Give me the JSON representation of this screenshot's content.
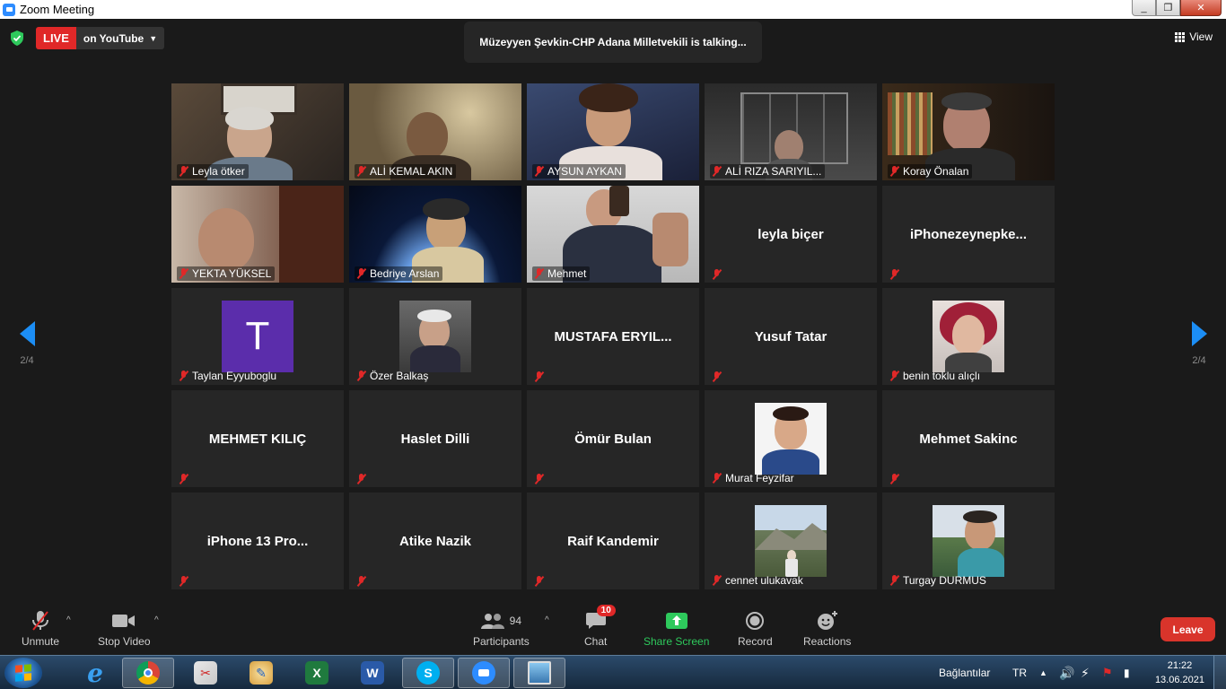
{
  "window": {
    "title": "Zoom Meeting",
    "buttons": [
      "_",
      "❐",
      "✕"
    ]
  },
  "topbar": {
    "live_label": "LIVE",
    "live_target": "on YouTube",
    "talking": "Müzeyyen Şevkin-CHP Adana Milletvekili is talking...",
    "view_label": "View"
  },
  "pagination": {
    "left": "2/4",
    "right": "2/4"
  },
  "tiles": [
    {
      "name": "Leyla ötker",
      "kind": "video"
    },
    {
      "name": "ALİ KEMAL AKIN",
      "kind": "video"
    },
    {
      "name": "AYSUN AYKAN",
      "kind": "video"
    },
    {
      "name": "ALİ RIZA SARIYIL...",
      "kind": "video"
    },
    {
      "name": "Koray Önalan",
      "kind": "video"
    },
    {
      "name": "YEKTA YÜKSEL",
      "kind": "video"
    },
    {
      "name": "Bedriye Arslan",
      "kind": "video"
    },
    {
      "name": "Mehmet",
      "kind": "video"
    },
    {
      "name": "leyla biçer",
      "kind": "name"
    },
    {
      "name": "iPhonezeynepke...",
      "kind": "name"
    },
    {
      "name": "Taylan Eyyuboglu",
      "kind": "avatar",
      "initial": "T"
    },
    {
      "name": "Özer Balkaş",
      "kind": "avatar"
    },
    {
      "name": "MUSTAFA ERYIL...",
      "kind": "name"
    },
    {
      "name": "Yusuf Tatar",
      "kind": "name"
    },
    {
      "name": "benin toklu alıçlı",
      "kind": "avatar"
    },
    {
      "name": "MEHMET KILIÇ",
      "kind": "name"
    },
    {
      "name": "Haslet Dilli",
      "kind": "name"
    },
    {
      "name": "Ömür Bulan",
      "kind": "name"
    },
    {
      "name": "Murat Feyzifar",
      "kind": "avatar"
    },
    {
      "name": "Mehmet Sakinc",
      "kind": "name"
    },
    {
      "name": "iPhone 13 Pro...",
      "kind": "name"
    },
    {
      "name": "Atike Nazik",
      "kind": "name"
    },
    {
      "name": "Raif Kandemir",
      "kind": "name"
    },
    {
      "name": "cennet ulukavak",
      "kind": "avatar"
    },
    {
      "name": "Turgay DURMUS",
      "kind": "avatar"
    }
  ],
  "toolbar": {
    "unmute": "Unmute",
    "stop_video": "Stop Video",
    "participants": "Participants",
    "participants_count": "94",
    "chat": "Chat",
    "chat_badge": "10",
    "share_screen": "Share Screen",
    "record": "Record",
    "reactions": "Reactions",
    "leave": "Leave"
  },
  "taskbar": {
    "network_label": "Bağlantılar",
    "language": "TR",
    "time": "21:22",
    "date": "13.06.2021"
  },
  "colors": {
    "accent_blue": "#1c8ef5",
    "live_red": "#e02828",
    "leave_red": "#d9342b",
    "share_green": "#2ec95c",
    "avatar_purple": "#5b2dab"
  }
}
